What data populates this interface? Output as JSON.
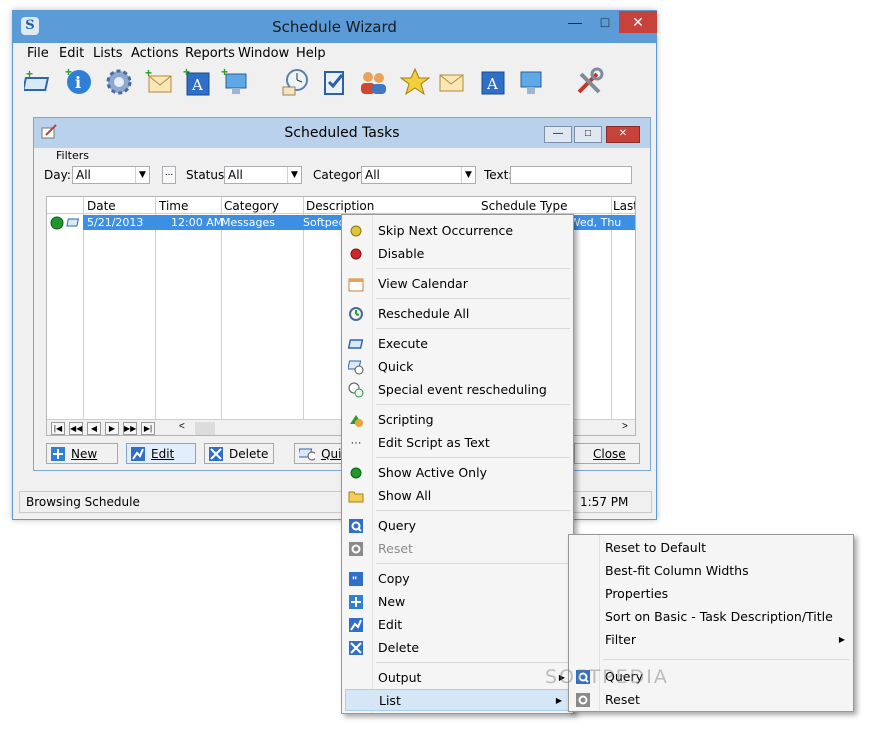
{
  "window": {
    "title": "Schedule Wizard",
    "minimize": "—",
    "maximize": "□",
    "close": "✕"
  },
  "menu": [
    "File",
    "Edit",
    "Lists",
    "Actions",
    "Reports",
    "Window",
    "Help"
  ],
  "toolbar_icons": [
    "execute-icon",
    "info-icon",
    "gear-icon",
    "mail-add-icon",
    "font-add-icon",
    "monitor-add-icon",
    "clock-icon",
    "check-pen-icon",
    "users-icon",
    "star-icon",
    "mail-icon",
    "font-icon",
    "monitor-icon",
    "tools-icon"
  ],
  "child": {
    "title": "Scheduled Tasks",
    "filters_label": "Filters",
    "day_label": "Day:",
    "day_value": "All",
    "dots": "...",
    "status_label": "Status:",
    "status_value": "All",
    "category_label": "Category:",
    "category_value": "All",
    "text_label": "Text:",
    "text_value": ""
  },
  "grid": {
    "columns": [
      "Date",
      "Time",
      "Category",
      "Description",
      "Schedule Type",
      "Last"
    ],
    "rows": [
      {
        "date": "5/21/2013",
        "time": "12:00 AM",
        "category": "Messages",
        "description": "Softpedia test",
        "schedule_type": "Days: Mon, Tue, Wed, Thu"
      }
    ]
  },
  "bottom_buttons": {
    "new": "New",
    "edit": "Edit",
    "delete": "Delete",
    "quick": "Quick",
    "close": "Close"
  },
  "status": {
    "text": "Browsing Schedule",
    "time": "1:57 PM"
  },
  "context_menu": {
    "items": [
      {
        "label": "Skip Next Occurrence",
        "icon": "yellow-dot-icon"
      },
      {
        "label": "Disable",
        "icon": "red-dot-icon"
      },
      {
        "label": "View Calendar",
        "icon": "calendar-icon"
      },
      {
        "label": "Reschedule All",
        "icon": "reschedule-icon"
      },
      {
        "label": "Execute",
        "icon": "execute-icon"
      },
      {
        "label": "Quick",
        "icon": "quick-icon"
      },
      {
        "label": "Special event rescheduling",
        "icon": "special-event-icon"
      },
      {
        "label": "Scripting",
        "icon": "scripting-icon"
      },
      {
        "label": "Edit Script as Text",
        "icon": "ellipsis-icon"
      },
      {
        "label": "Show Active Only",
        "icon": "green-dot-icon"
      },
      {
        "label": "Show All",
        "icon": "folder-icon"
      },
      {
        "label": "Query",
        "icon": "query-icon"
      },
      {
        "label": "Reset",
        "icon": "reset-icon",
        "disabled": true
      },
      {
        "label": "Copy",
        "icon": "copy-icon"
      },
      {
        "label": "New",
        "icon": "new-icon"
      },
      {
        "label": "Edit",
        "icon": "edit-icon"
      },
      {
        "label": "Delete",
        "icon": "delete-icon"
      },
      {
        "label": "Output",
        "submenu": true
      },
      {
        "label": "List",
        "submenu": true,
        "highlighted": true
      }
    ]
  },
  "submenu": {
    "items": [
      {
        "label": "Reset to Default"
      },
      {
        "label": "Best-fit Column Widths"
      },
      {
        "label": "Properties"
      },
      {
        "label": "Sort on Basic - Task Description/Title"
      },
      {
        "label": "Filter",
        "submenu": true
      },
      {
        "label": "Query",
        "icon": "query-icon"
      },
      {
        "label": "Reset",
        "icon": "reset-icon"
      }
    ]
  },
  "watermark": "SOFTPEDIA",
  "colors": {
    "titlebar": "#5b9bd8",
    "selection": "#3c8fe3",
    "close_button": "#c7423b"
  }
}
